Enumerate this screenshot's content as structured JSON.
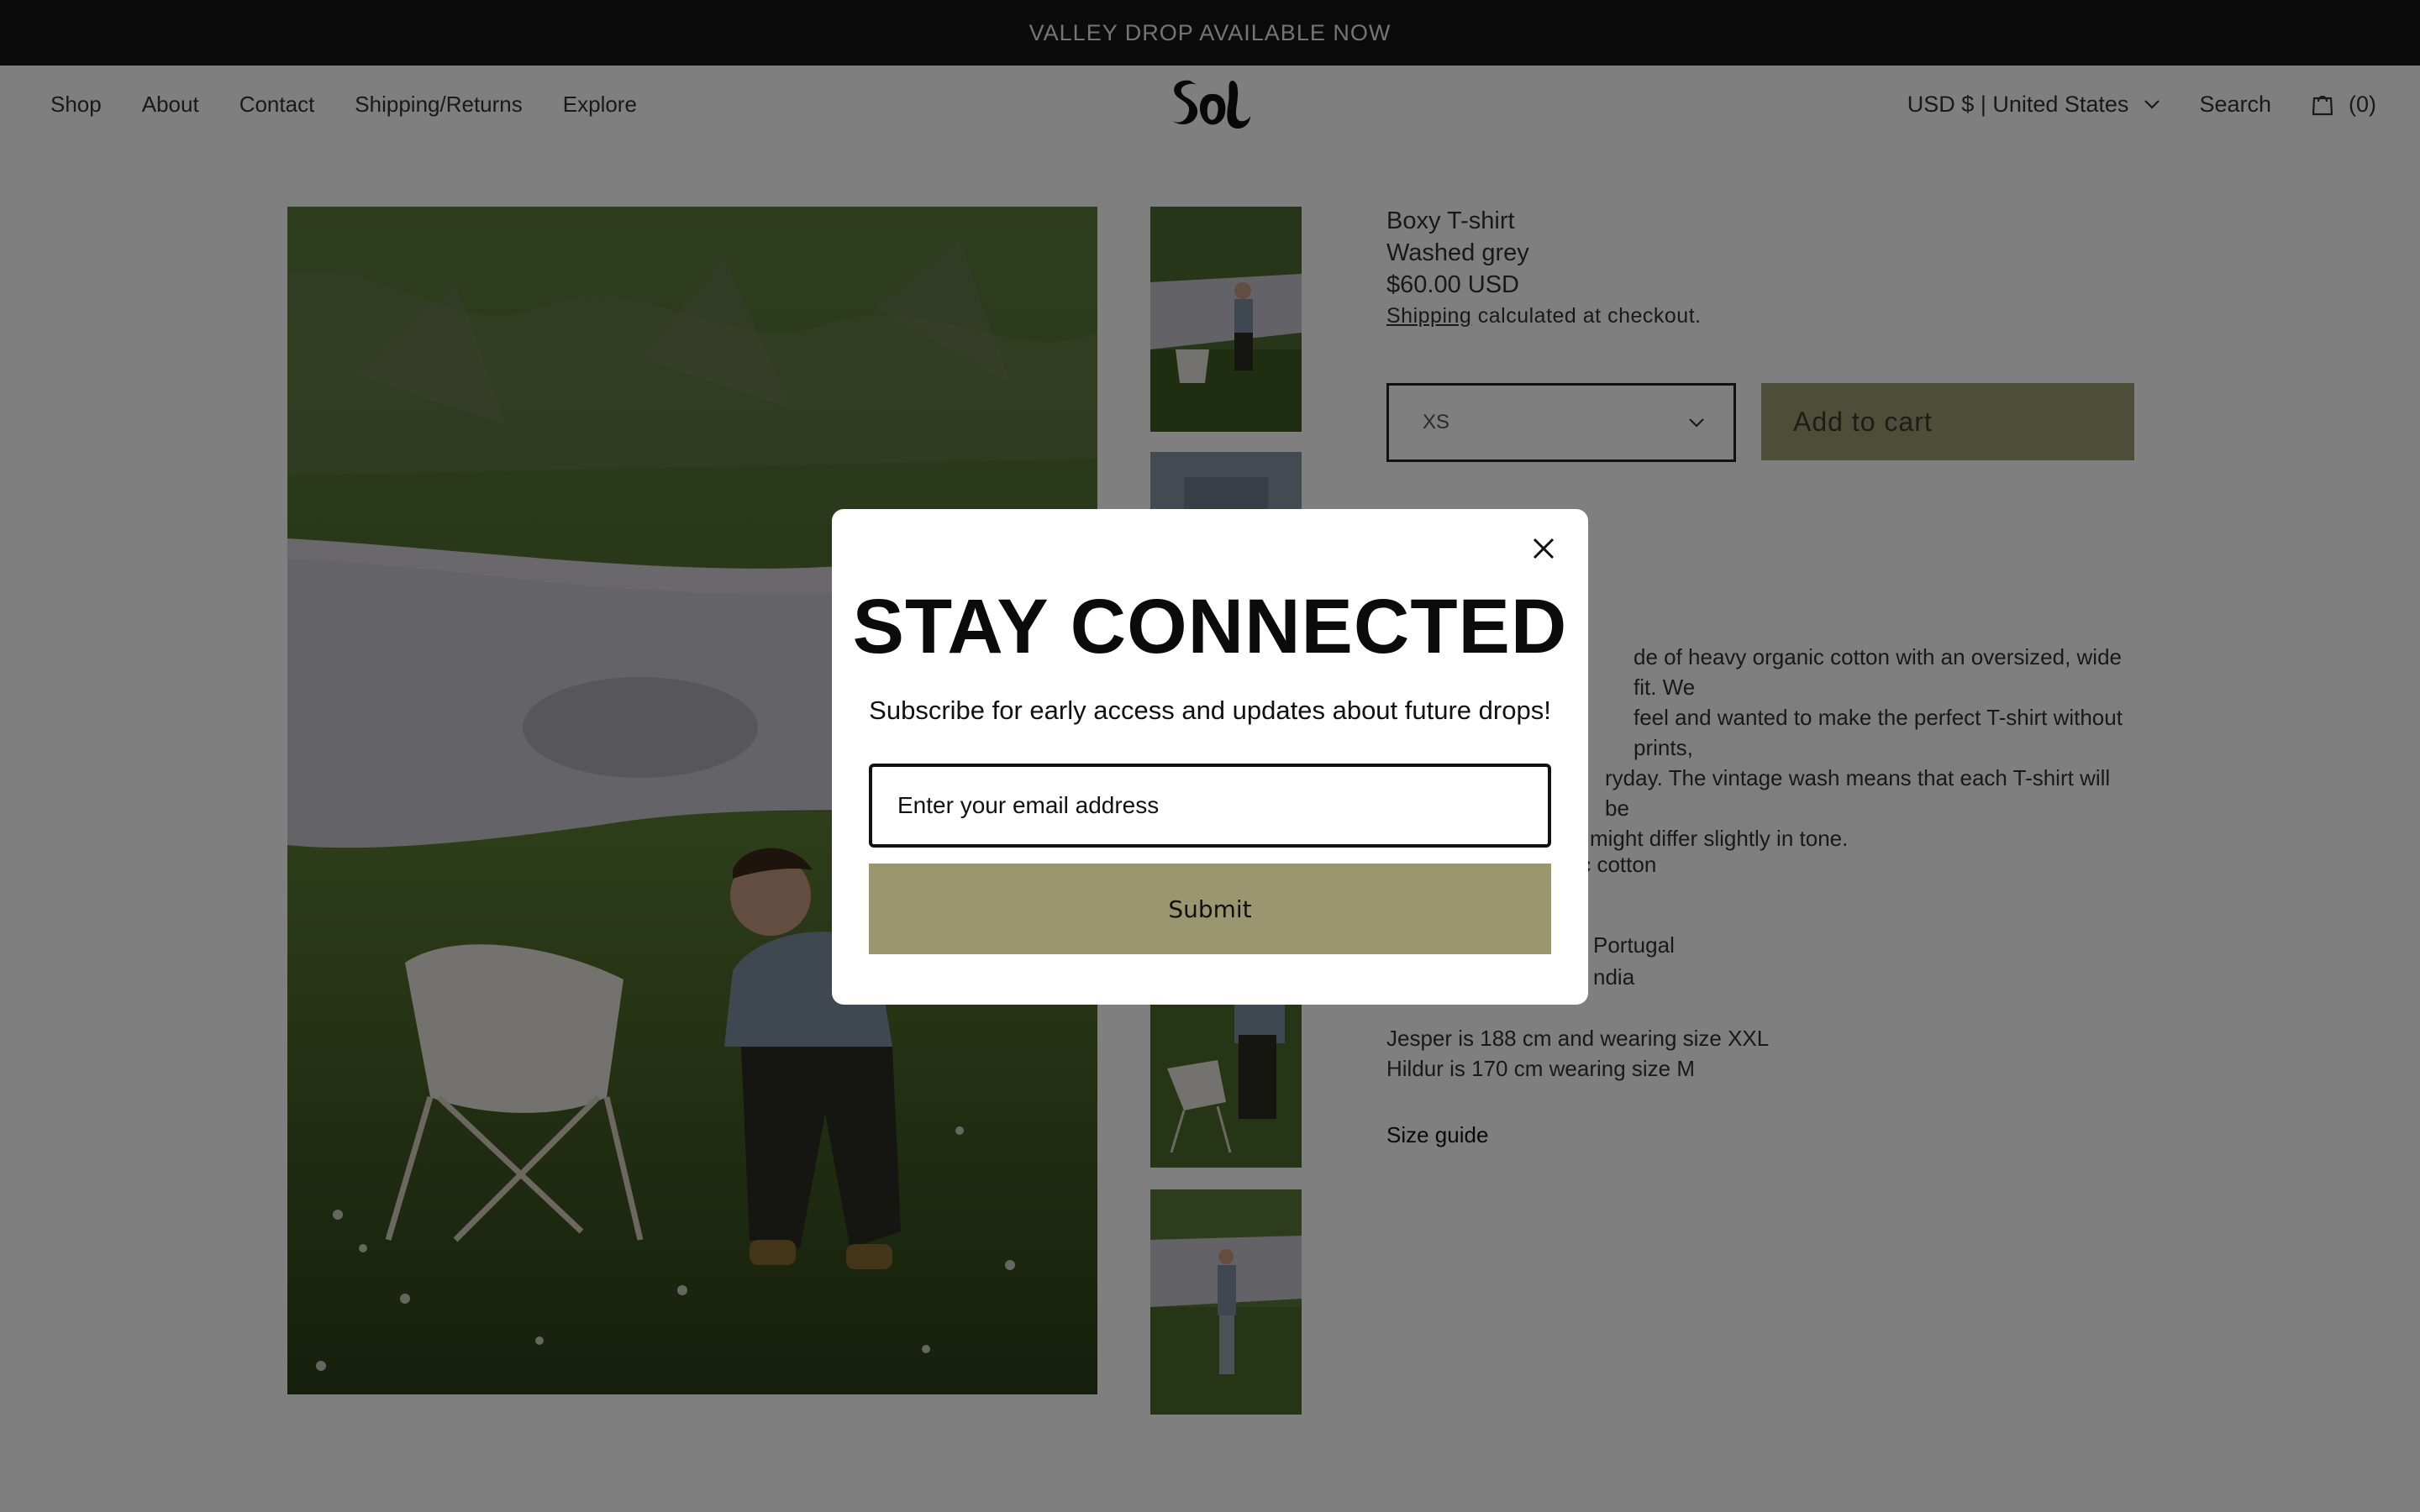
{
  "announcement": "VALLEY DROP AVAILABLE NOW",
  "nav": {
    "items": [
      "Shop",
      "About",
      "Contact",
      "Shipping/Returns",
      "Explore"
    ],
    "logo_text": "Sol",
    "currency": "USD $ | United States",
    "search": "Search",
    "cart_count": "(0)"
  },
  "product": {
    "title": "Boxy T-shirt",
    "color": "Washed grey",
    "price": "$60.00 USD",
    "shipping_link": "Shipping",
    "shipping_rest": " calculated at checkout.",
    "size_selected": "XS",
    "add_to_cart": "Add to cart",
    "description": "de of heavy organic cotton with an oversized, wide fit. We feel and wanted to make the perfect T-shirt without prints, ryday. The vintage wash means that each T-shirt will be might differ slightly in tone.",
    "desc_lines": [
      "de of heavy organic cotton with an oversized, wide fit. We",
      "feel and wanted to make the perfect T-shirt without prints,",
      "ryday. The vintage wash means that each T-shirt will be",
      "might differ slightly in tone."
    ],
    "material_lines": [
      "nic cotton",
      "",
      "Portugal",
      "ndia"
    ],
    "fit_lines": [
      "Jesper is 188 cm and wearing size XXL",
      "Hildur is 170 cm wearing size M"
    ],
    "size_guide": "Size guide"
  },
  "modal": {
    "title": "STAY CONNECTED",
    "subtitle": "Subscribe for early access and updates about future drops!",
    "email_placeholder": "Enter your email address",
    "submit": "Submit"
  },
  "colors": {
    "accent_olive": "#9a9670",
    "announcement_bg": "#161616"
  }
}
